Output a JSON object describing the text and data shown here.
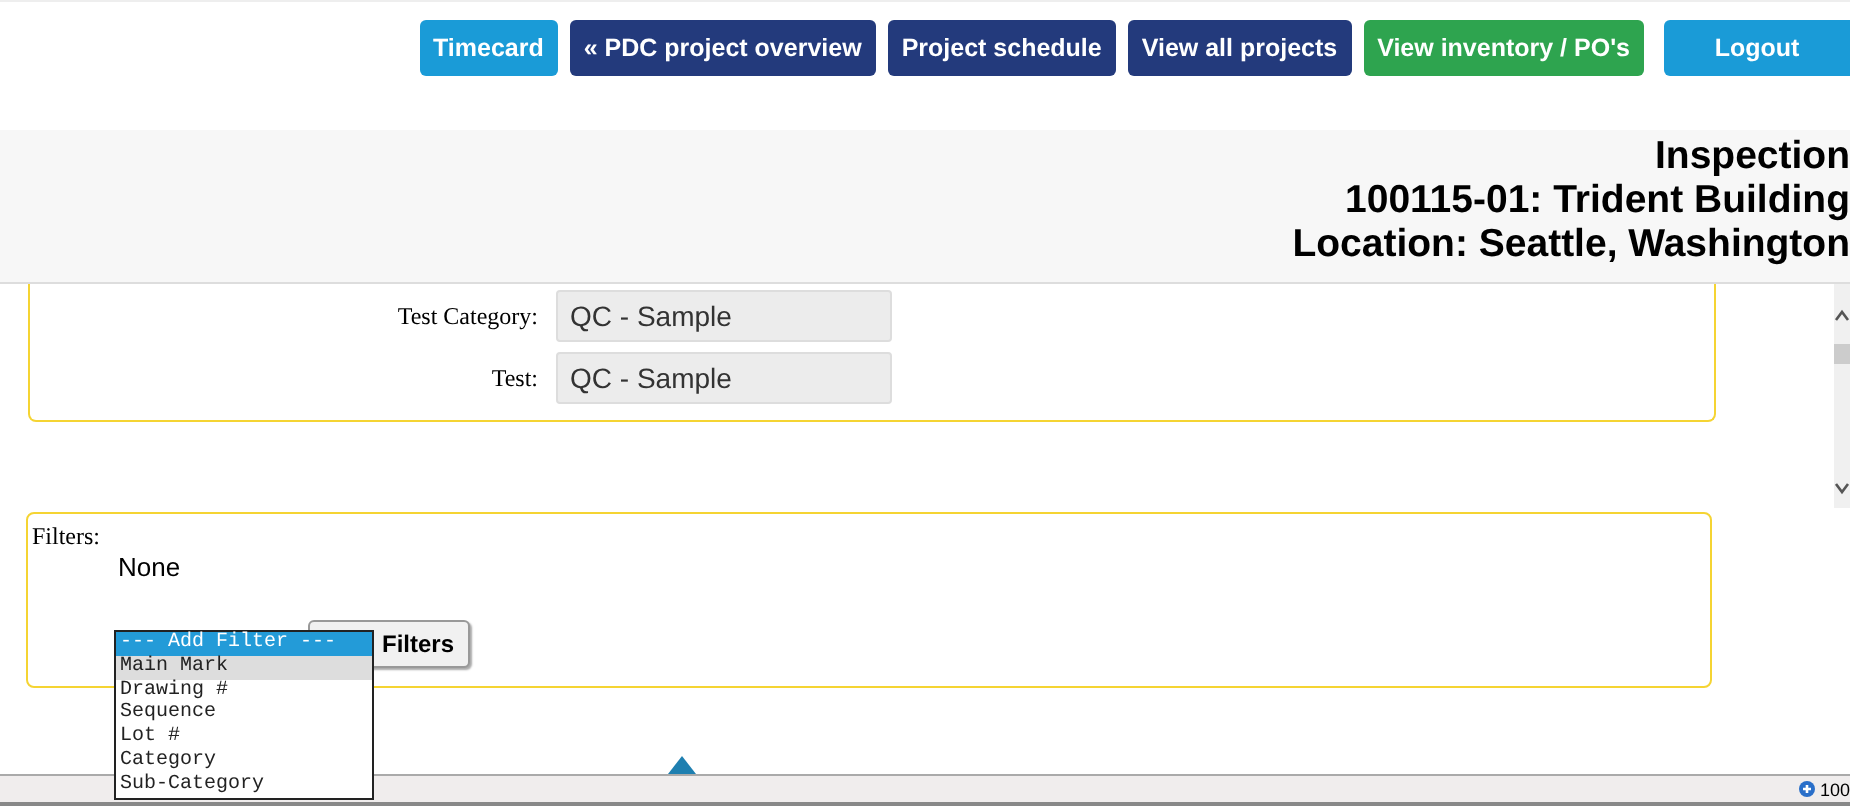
{
  "nav_buttons": [
    {
      "label": "Timecard",
      "kind": "light"
    },
    {
      "label": "« PDC project overview",
      "kind": "dark"
    },
    {
      "label": "Project schedule",
      "kind": "dark"
    },
    {
      "label": "View all projects",
      "kind": "dark"
    },
    {
      "label": "View inventory / PO's",
      "kind": "green"
    },
    {
      "label": "Logout",
      "kind": "logout"
    }
  ],
  "header": {
    "lines": [
      "Inspection",
      "100115-01: Trident Building",
      "Location: Seattle, Washington"
    ]
  },
  "test_fields": [
    {
      "label": "Test Category:",
      "value": "QC - Sample"
    },
    {
      "label": "Test:",
      "value": "QC - Sample"
    }
  ],
  "filters": {
    "label": "Filters:",
    "current": "None",
    "button": "Filters",
    "dropdown": [
      {
        "label": "--- Add Filter ---",
        "selected": true,
        "hovered": false
      },
      {
        "label": "Main Mark",
        "selected": false,
        "hovered": true
      },
      {
        "label": "Drawing #",
        "selected": false,
        "hovered": false
      },
      {
        "label": "Sequence",
        "selected": false,
        "hovered": false
      },
      {
        "label": "Lot #",
        "selected": false,
        "hovered": false
      },
      {
        "label": "Category",
        "selected": false,
        "hovered": false
      },
      {
        "label": "Sub-Category",
        "selected": false,
        "hovered": false
      }
    ]
  },
  "status_bar": {
    "zoom": "100"
  }
}
